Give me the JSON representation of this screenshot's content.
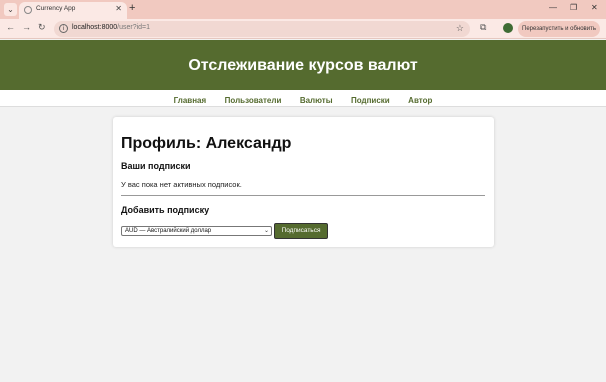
{
  "browser": {
    "tab_title": "Currency App",
    "url_host": "localhost:8000",
    "url_path": "/user?id=1",
    "restart_label": "Перезапустить и обновить"
  },
  "site": {
    "title": "Отслеживание курсов валют",
    "nav": [
      "Главная",
      "Пользователи",
      "Валюты",
      "Подписки",
      "Автор"
    ]
  },
  "profile": {
    "heading": "Профиль: Александр",
    "subscriptions_title": "Ваши подписки",
    "empty_message": "У вас пока нет активных подписок.",
    "add_title": "Добавить подписку",
    "selected_currency": "AUD — Австралийский доллар",
    "subscribe_label": "Подписаться"
  },
  "colors": {
    "header_bg": "#556b2f",
    "tab_bar_bg": "#f1c9c0"
  }
}
